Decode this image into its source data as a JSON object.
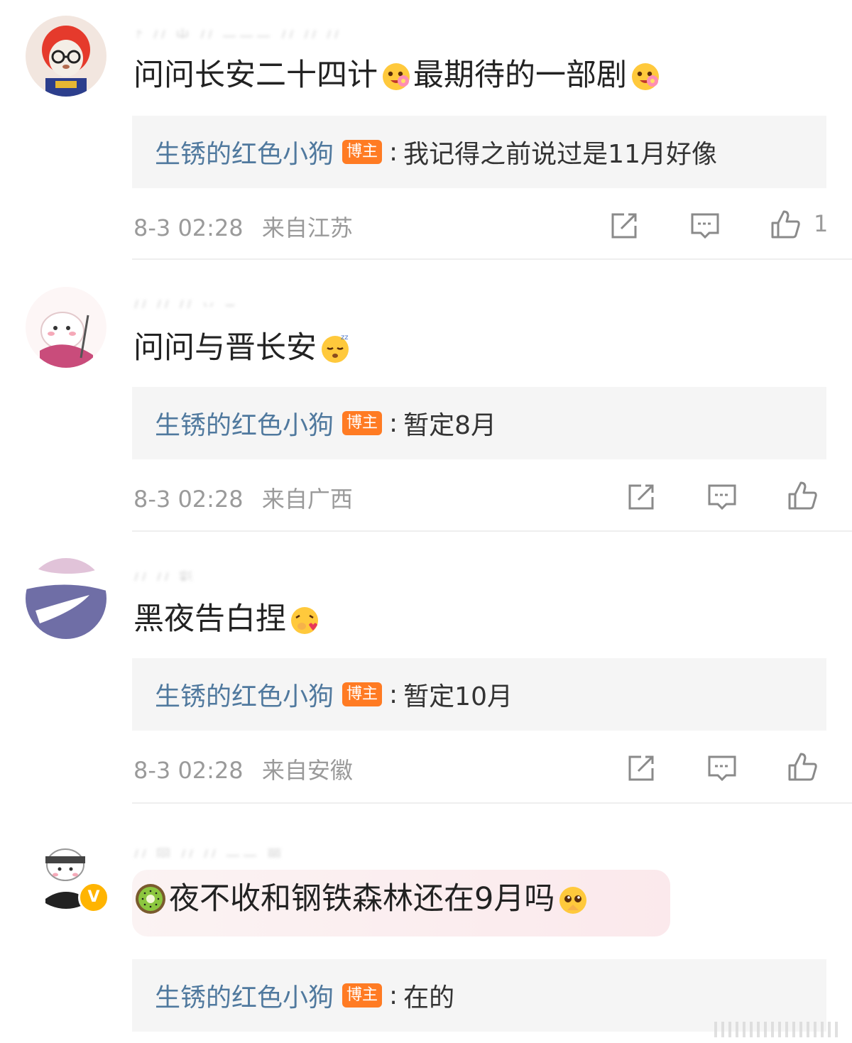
{
  "comments": [
    {
      "username": "♪ ∕∕ 屮 ∕∕ ——— ∕∕ ∕∕ ∕∕",
      "text": "问问长安二十四计",
      "text_mid": "最期待的一部剧",
      "emoji1": "flower-face-icon",
      "emoji2": "flower-face-icon",
      "reply": {
        "name": "生锈的红色小狗",
        "badge": "博主",
        "colon": ":",
        "text": "我记得之前说过是11月好像"
      },
      "time": "8-3 02:28",
      "location": "来自江苏",
      "likes": "1"
    },
    {
      "username": "∕∕ ∕∕ ∕∕ 丷 ─",
      "text": "问问与晋长安",
      "emoji1": "sleeping-face-icon",
      "reply": {
        "name": "生锈的红色小狗",
        "badge": "博主",
        "colon": ":",
        "text": "暂定8月"
      },
      "time": "8-3 02:28",
      "location": "来自广西"
    },
    {
      "username": "∕∕ ∕∕ 彩",
      "text": "黑夜告白捏",
      "emoji1": "kissing-heart-face-icon",
      "reply": {
        "name": "生锈的红色小狗",
        "badge": "博主",
        "colon": ":",
        "text": "暂定10月"
      },
      "time": "8-3 02:28",
      "location": "来自安徽"
    },
    {
      "username": "∕∕ 回 ∕∕ ∕∕ —— 丽",
      "text": "夜不收和钢铁森林还在9月吗",
      "emoji_lead": "kiwi-icon",
      "emoji1": "pleading-face-icon",
      "verified": "V",
      "reply": {
        "name": "生锈的红色小狗",
        "badge": "博主",
        "colon": ":",
        "text": "在的"
      }
    }
  ],
  "colors": {
    "reply_name": "#50799e",
    "badge_bg": "#ff7b23",
    "meta_text": "#9a9a9a",
    "reply_bg": "#f5f5f5"
  }
}
